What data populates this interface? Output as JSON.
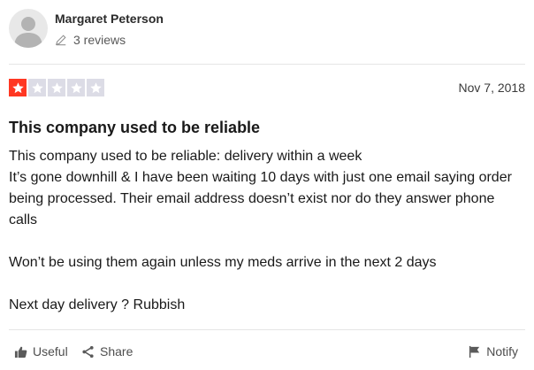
{
  "author": {
    "name": "Margaret Peterson",
    "reviews_count": "3 reviews"
  },
  "review": {
    "rating": 1,
    "max_rating": 5,
    "date": "Nov 7, 2018",
    "title": "This company used to be reliable",
    "paragraphs": [
      "This company used to be reliable: delivery within a week",
      "It’s gone downhill & I have been waiting 10 days with just one email saying order being processed. Their email address doesn’t exist nor do they answer phone calls",
      "Won’t be using them again unless my meds arrive in the next 2 days",
      "Next day delivery ? Rubbish"
    ]
  },
  "actions": {
    "useful": "Useful",
    "share": "Share",
    "notify": "Notify"
  },
  "colors": {
    "star_filled": "#ff3722",
    "star_empty": "#dcdce6"
  }
}
